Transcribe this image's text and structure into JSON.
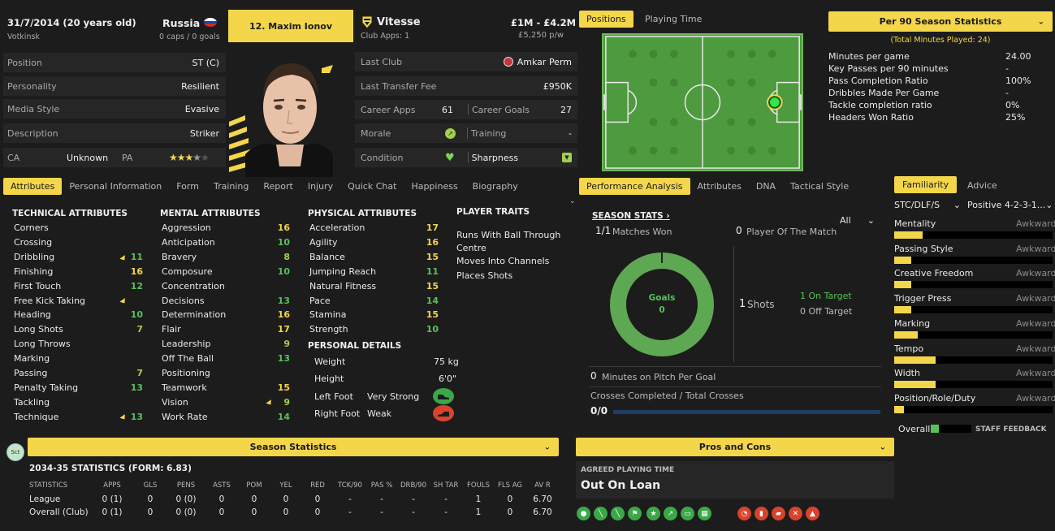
{
  "header": {
    "dob": "31/7/2014 (20 years old)",
    "town": "Votkinsk",
    "nation": "Russia",
    "caps": "0 caps / 0 goals",
    "player_name": "12. Maxim Ionov",
    "club": "Vitesse",
    "club_apps": "Club Apps: 1",
    "value": "£1M - £4.2M",
    "wage": "£5,250 p/w"
  },
  "info_left": [
    {
      "label": "Position",
      "value": "ST (C)"
    },
    {
      "label": "Personality",
      "value": "Resilient"
    },
    {
      "label": "Media Style",
      "value": "Evasive"
    },
    {
      "label": "Description",
      "value": "Striker"
    }
  ],
  "ability": {
    "ca_label": "CA",
    "ca_value": "Unknown",
    "pa_label": "PA",
    "pa_stars": 3.5
  },
  "info_right": {
    "last_club_label": "Last Club",
    "last_club": "Amkar Perm",
    "fee_label": "Last Transfer Fee",
    "fee": "£950K",
    "career_apps_label": "Career Apps",
    "career_apps": "61",
    "career_goals_label": "Career Goals",
    "career_goals": "27",
    "morale_label": "Morale",
    "training_label": "Training",
    "training": "-",
    "condition_label": "Condition",
    "sharpness_label": "Sharpness"
  },
  "tabs": [
    "Attributes",
    "Personal Information",
    "Form",
    "Training",
    "Report",
    "Injury",
    "Quick Chat",
    "Happiness",
    "Biography"
  ],
  "technical": {
    "title": "TECHNICAL ATTRIBUTES",
    "items": [
      {
        "name": "Corners",
        "value": ""
      },
      {
        "name": "Crossing",
        "value": ""
      },
      {
        "name": "Dribbling",
        "value": "11"
      },
      {
        "name": "Finishing",
        "value": "16"
      },
      {
        "name": "First Touch",
        "value": "12"
      },
      {
        "name": "Free Kick Taking",
        "value": ""
      },
      {
        "name": "Heading",
        "value": "10"
      },
      {
        "name": "Long Shots",
        "value": "7"
      },
      {
        "name": "Long Throws",
        "value": ""
      },
      {
        "name": "Marking",
        "value": ""
      },
      {
        "name": "Passing",
        "value": "7"
      },
      {
        "name": "Penalty Taking",
        "value": "13"
      },
      {
        "name": "Tackling",
        "value": ""
      },
      {
        "name": "Technique",
        "value": "13"
      }
    ]
  },
  "mental": {
    "title": "MENTAL ATTRIBUTES",
    "items": [
      {
        "name": "Aggression",
        "value": "16"
      },
      {
        "name": "Anticipation",
        "value": "10"
      },
      {
        "name": "Bravery",
        "value": "8"
      },
      {
        "name": "Composure",
        "value": "10"
      },
      {
        "name": "Concentration",
        "value": ""
      },
      {
        "name": "Decisions",
        "value": "13"
      },
      {
        "name": "Determination",
        "value": "16"
      },
      {
        "name": "Flair",
        "value": "17"
      },
      {
        "name": "Leadership",
        "value": "9"
      },
      {
        "name": "Off The Ball",
        "value": "13"
      },
      {
        "name": "Positioning",
        "value": ""
      },
      {
        "name": "Teamwork",
        "value": "15"
      },
      {
        "name": "Vision",
        "value": "9"
      },
      {
        "name": "Work Rate",
        "value": "14"
      }
    ]
  },
  "physical": {
    "title": "PHYSICAL ATTRIBUTES",
    "items": [
      {
        "name": "Acceleration",
        "value": "17"
      },
      {
        "name": "Agility",
        "value": "16"
      },
      {
        "name": "Balance",
        "value": "15"
      },
      {
        "name": "Jumping Reach",
        "value": "11"
      },
      {
        "name": "Natural Fitness",
        "value": "15"
      },
      {
        "name": "Pace",
        "value": "14"
      },
      {
        "name": "Stamina",
        "value": "15"
      },
      {
        "name": "Strength",
        "value": "10"
      }
    ]
  },
  "personal": {
    "title": "PERSONAL DETAILS",
    "weight_label": "Weight",
    "weight": "75 kg",
    "height_label": "Height",
    "height": "6'0\"",
    "left_foot_label": "Left Foot",
    "left_foot": "Very Strong",
    "right_foot_label": "Right Foot",
    "right_foot": "Weak"
  },
  "traits": {
    "title": "PLAYER TRAITS",
    "items": [
      "Runs With Ball Through Centre",
      "Moves Into Channels",
      "Places Shots"
    ]
  },
  "right_tabs": {
    "positions": "Positions",
    "playing_time": "Playing Time"
  },
  "per90": {
    "title": "Per 90 Season Statistics",
    "total": "(Total Minutes Played: 24)",
    "rows": [
      {
        "label": "Minutes per game",
        "value": "24.00"
      },
      {
        "label": "Key Passes per 90 minutes",
        "value": "-"
      },
      {
        "label": "Pass Completion Ratio",
        "value": "100%"
      },
      {
        "label": "Dribbles Made Per Game",
        "value": "-"
      },
      {
        "label": "Tackle completion ratio",
        "value": "0%"
      },
      {
        "label": "Headers Won Ratio",
        "value": "25%"
      }
    ]
  },
  "perf_tabs": [
    "Performance Analysis",
    "Attributes",
    "DNA",
    "Tactical Style"
  ],
  "season_stats": {
    "title": "SEASON STATS",
    "filter": "All",
    "matches_won_num": "1/1",
    "matches_won": "Matches Won",
    "potm_num": "0",
    "potm": "Player Of The Match",
    "goals_label": "Goals",
    "goals": "0",
    "shots_num": "1",
    "shots": "Shots",
    "on_target": "1 On Target",
    "off_target": "0 Off Target",
    "mins_num": "0",
    "mins": "Minutes on Pitch Per Goal",
    "crosses_label": "Crosses Completed / Total Crosses",
    "crosses": "0/0"
  },
  "familiarity": {
    "tab": "Familiarity",
    "advice_tab": "Advice",
    "role": "STC/DLF/S",
    "formation": "Positive 4-2-3-1...",
    "rows": [
      {
        "label": "Mentality",
        "value": "Awkward",
        "fill": 0.18
      },
      {
        "label": "Passing Style",
        "value": "Awkward",
        "fill": 0.11
      },
      {
        "label": "Creative Freedom",
        "value": "Awkward",
        "fill": 0.11
      },
      {
        "label": "Trigger Press",
        "value": "Awkward",
        "fill": 0.11
      },
      {
        "label": "Marking",
        "value": "Awkward",
        "fill": 0.15
      },
      {
        "label": "Tempo",
        "value": "Awkward",
        "fill": 0.26
      },
      {
        "label": "Width",
        "value": "Awkward",
        "fill": 0.26
      },
      {
        "label": "Position/Role/Duty",
        "value": "Awkward",
        "fill": 0.06
      }
    ],
    "overall_label": "Overall",
    "staff": "STAFF FEEDBACK"
  },
  "season_statistics": {
    "bar": "Season Statistics",
    "badge": "Sct",
    "title": "2034-35 STATISTICS (FORM: 6.83)",
    "headers": [
      "STATISTICS",
      "APPS",
      "GLS",
      "PENS",
      "ASTS",
      "POM",
      "YEL",
      "RED",
      "TCK/90",
      "PAS %",
      "DRB/90",
      "SH TAR",
      "FOULS",
      "FLS AG",
      "AV R"
    ],
    "rows": [
      [
        "League",
        "0 (1)",
        "0",
        "0 (0)",
        "0",
        "0",
        "0",
        "0",
        "-",
        "-",
        "-",
        "-",
        "1",
        "0",
        "6.70"
      ],
      [
        "Overall (Club)",
        "0 (1)",
        "0",
        "0 (0)",
        "0",
        "0",
        "0",
        "0",
        "-",
        "-",
        "-",
        "-",
        "1",
        "0",
        "6.70"
      ]
    ]
  },
  "pros_cons": {
    "bar": "Pros and Cons",
    "label": "AGREED PLAYING TIME",
    "value": "Out On Loan"
  },
  "colors": {
    "accent": "#f4d64a",
    "green": "#56c15b",
    "red": "#d8432e",
    "bg": "#1c1c1c",
    "panel": "#262626"
  }
}
